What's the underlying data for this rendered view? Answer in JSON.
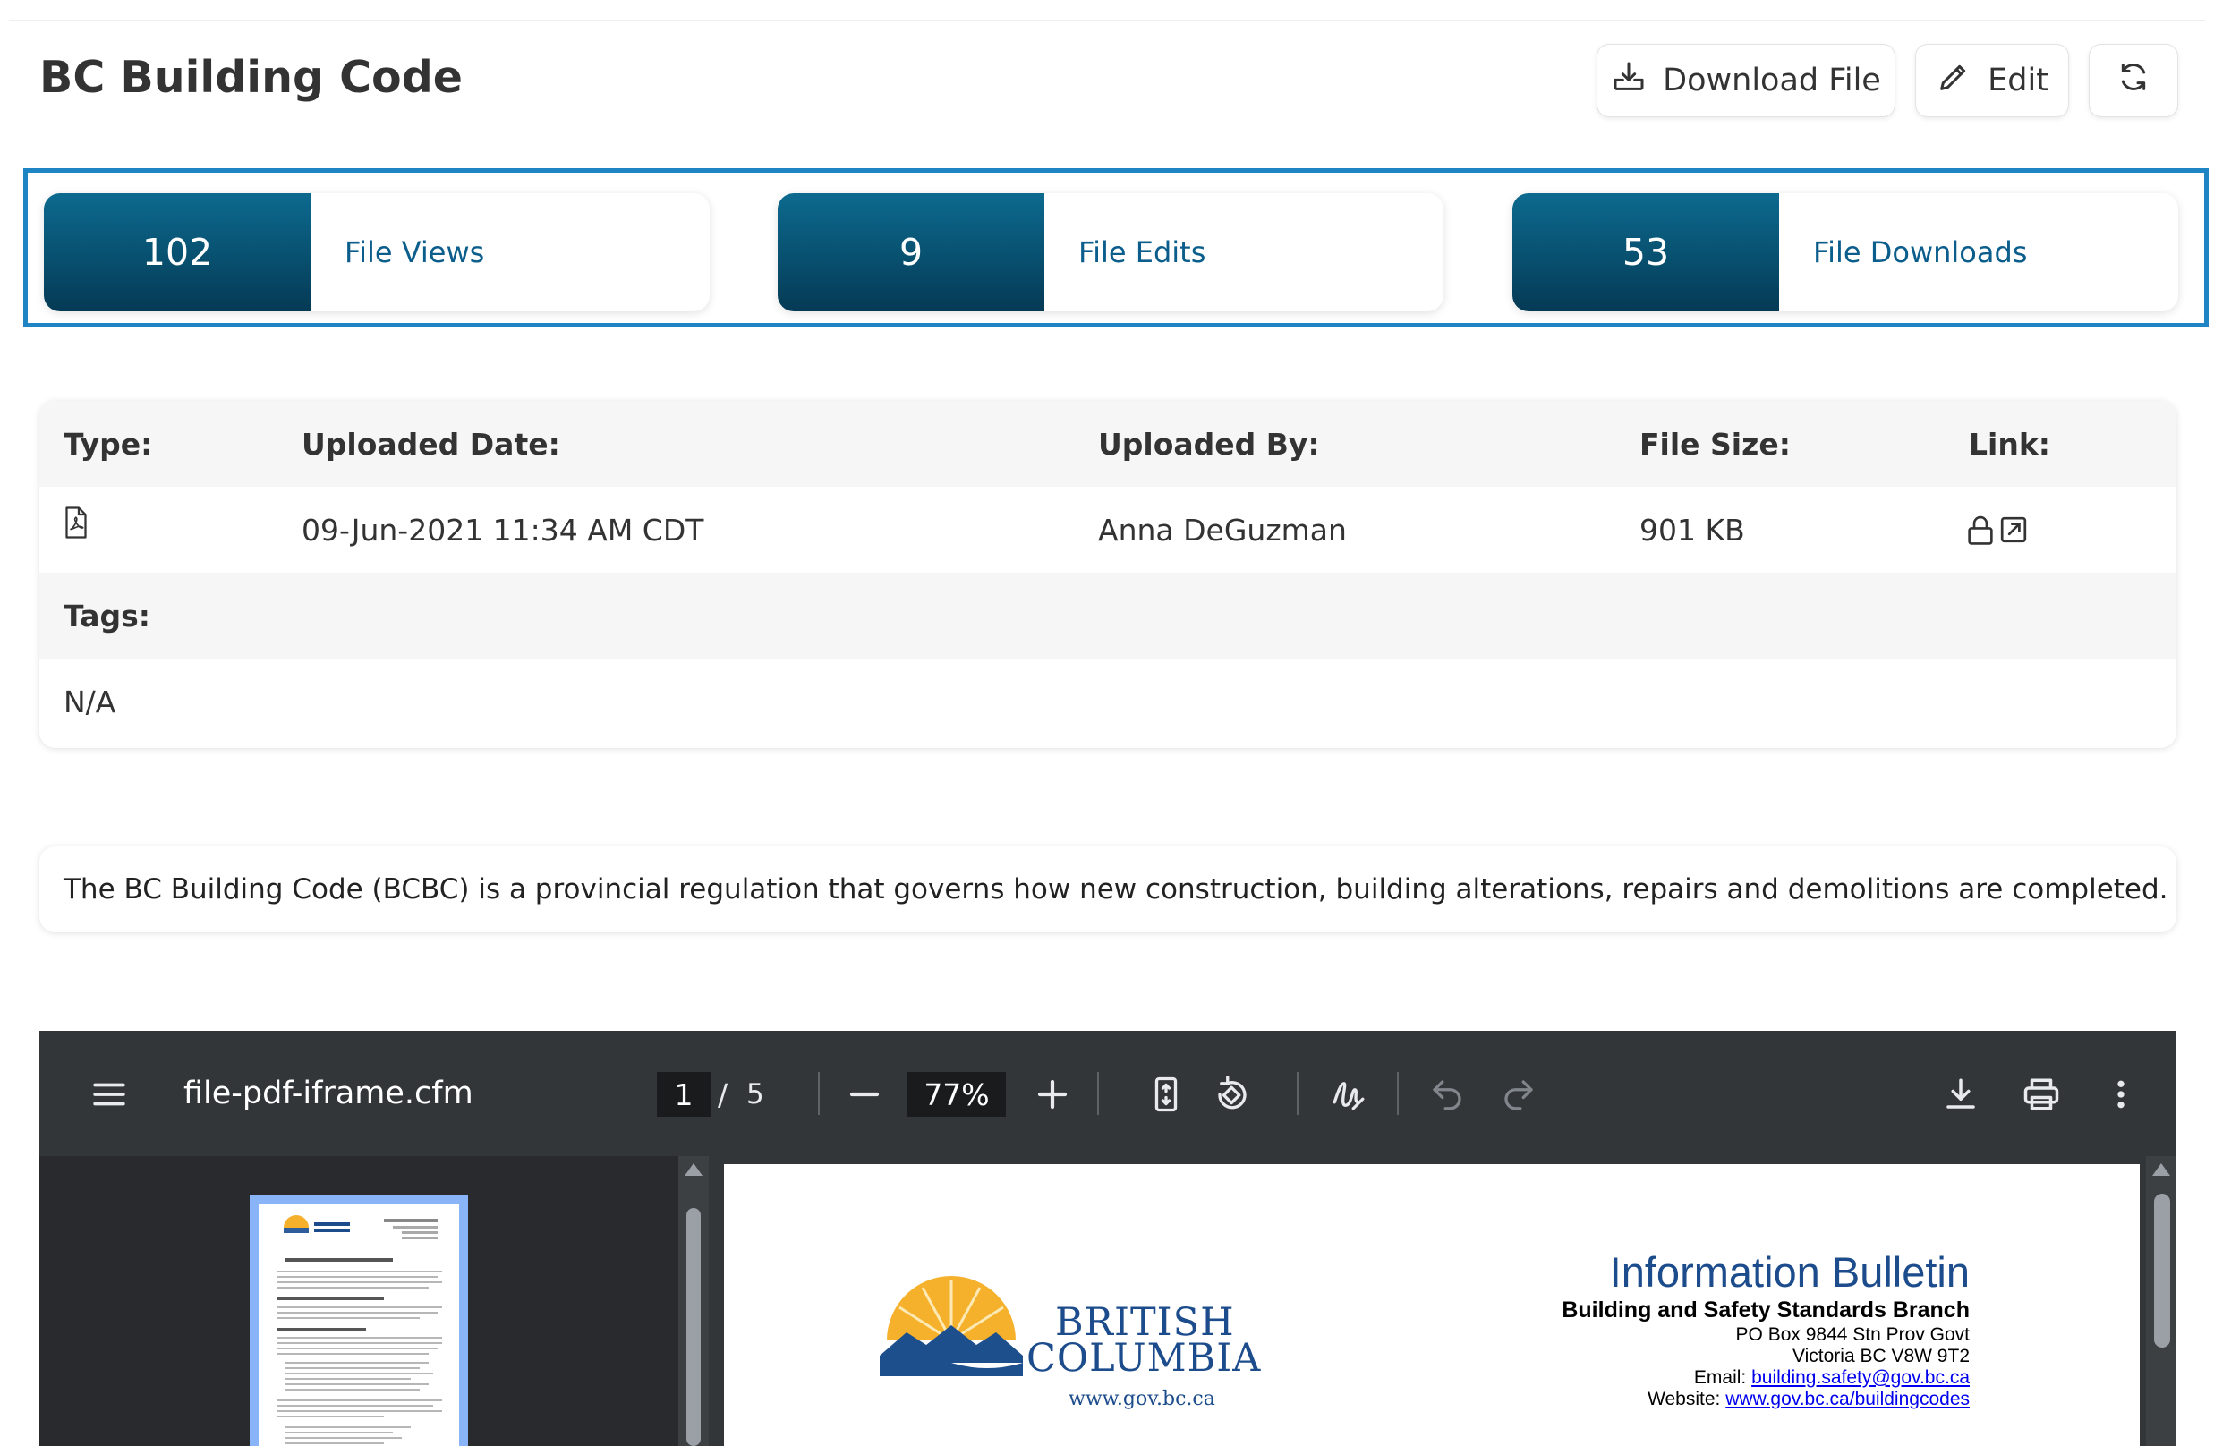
{
  "header": {
    "title": "BC Building Code",
    "download_label": "Download File",
    "edit_label": "Edit"
  },
  "stats": [
    {
      "value": "102",
      "label": "File Views"
    },
    {
      "value": "9",
      "label": "File Edits"
    },
    {
      "value": "53",
      "label": "File Downloads"
    }
  ],
  "details": {
    "headers": {
      "type": "Type:",
      "uploaded_date": "Uploaded Date:",
      "uploaded_by": "Uploaded By:",
      "file_size": "File Size:",
      "link": "Link:"
    },
    "values": {
      "type_icon": "pdf-file-icon",
      "uploaded_date": "09-Jun-2021 11:34 AM CDT",
      "uploaded_by": "Anna DeGuzman",
      "file_size": "901 KB"
    },
    "tags_label": "Tags:",
    "tags_value": "N/A"
  },
  "description": "The BC Building Code (BCBC) is a provincial regulation that governs how new construction, building alterations, repairs and demolitions are completed.",
  "viewer": {
    "filename": "file-pdf-iframe.cfm",
    "current_page": "1",
    "page_separator": "/",
    "total_pages": "5",
    "zoom": "77%",
    "page": {
      "logo_line1": "BRITISH",
      "logo_line2": "COLUMBIA",
      "logo_url": "www.gov.bc.ca",
      "bulletin_title": "Information Bulletin",
      "branch": "Building and Safety Standards Branch",
      "address1": "PO Box 9844 Stn Prov Govt",
      "address2": "Victoria BC  V8W 9T2",
      "email_label": "Email:",
      "email": "building.safety@gov.bc.ca",
      "website_label": "Website:",
      "website": "www.gov.bc.ca/buildingcodes"
    }
  },
  "colors": {
    "stat_gradient_top": "#0c6a8f",
    "stat_gradient_bottom": "#053a55",
    "stat_label": "#0b5d8c",
    "highlight_border": "#1f84c3",
    "viewer_toolbar": "#323639"
  }
}
